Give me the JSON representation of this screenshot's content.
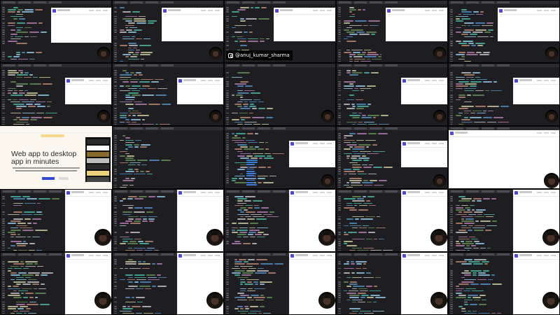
{
  "title": "Web app to desktop app in minutes — video preview grid",
  "grid": {
    "rows": 5,
    "columns": 5
  },
  "social_handle": {
    "platform": "instagram",
    "handle": "@anuj_kumar_sharma"
  },
  "hero": {
    "headline": "Web app to desktop app in minutes"
  },
  "icons": [
    "instagram-icon",
    "app-logo-icon"
  ],
  "colors": {
    "editor_bg": "#1e1e22",
    "accent": "#4f46e5",
    "hero_bg": "#fbf7ef",
    "cta": "#2e4bd8"
  }
}
